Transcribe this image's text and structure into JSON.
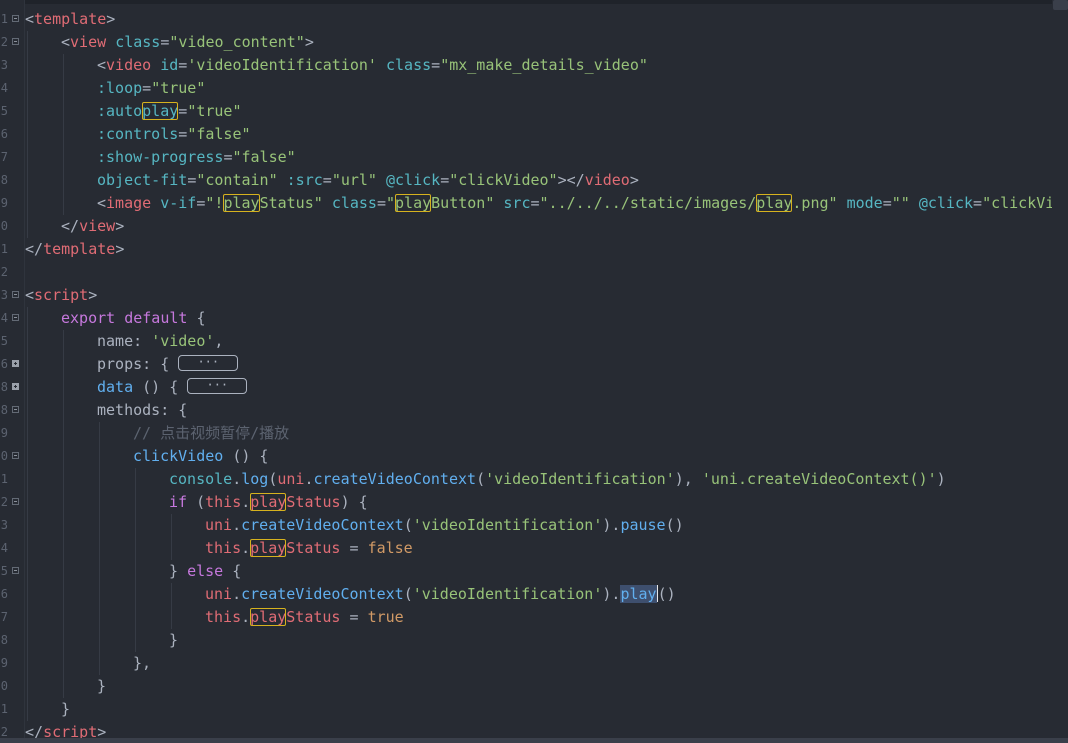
{
  "editor": {
    "lines": [
      {
        "num": "1",
        "fold": "minus",
        "tokens": [
          {
            "t": "<",
            "c": "plain"
          },
          {
            "t": "template",
            "c": "tag"
          },
          {
            "t": ">",
            "c": "plain"
          }
        ]
      },
      {
        "num": "2",
        "fold": "minus",
        "indent": 1,
        "tokens": [
          {
            "t": "<",
            "c": "plain"
          },
          {
            "t": "view",
            "c": "tag"
          },
          {
            "t": " ",
            "c": "plain"
          },
          {
            "t": "class",
            "c": "attr"
          },
          {
            "t": "=",
            "c": "plain"
          },
          {
            "t": "\"video_content\"",
            "c": "str"
          },
          {
            "t": ">",
            "c": "plain"
          }
        ]
      },
      {
        "num": "3",
        "indent": 2,
        "tokens": [
          {
            "t": "<",
            "c": "plain"
          },
          {
            "t": "video",
            "c": "tag"
          },
          {
            "t": " ",
            "c": "plain"
          },
          {
            "t": "id",
            "c": "attr"
          },
          {
            "t": "=",
            "c": "plain"
          },
          {
            "t": "'videoIdentification'",
            "c": "str"
          },
          {
            "t": " ",
            "c": "plain"
          },
          {
            "t": "class",
            "c": "attr"
          },
          {
            "t": "=",
            "c": "plain"
          },
          {
            "t": "\"mx_make_details_video\"",
            "c": "str"
          }
        ]
      },
      {
        "num": "4",
        "indent": 2,
        "tokens": [
          {
            "t": ":loop",
            "c": "attr"
          },
          {
            "t": "=",
            "c": "plain"
          },
          {
            "t": "\"true\"",
            "c": "str"
          }
        ]
      },
      {
        "num": "5",
        "indent": 2,
        "tokens": [
          {
            "t": ":auto",
            "c": "attr"
          },
          {
            "t": "play",
            "c": "attr",
            "hl": true
          },
          {
            "t": "=",
            "c": "plain"
          },
          {
            "t": "\"true\"",
            "c": "str"
          }
        ]
      },
      {
        "num": "6",
        "indent": 2,
        "tokens": [
          {
            "t": ":controls",
            "c": "attr"
          },
          {
            "t": "=",
            "c": "plain"
          },
          {
            "t": "\"false\"",
            "c": "str"
          }
        ]
      },
      {
        "num": "7",
        "indent": 2,
        "tokens": [
          {
            "t": ":show-progress",
            "c": "attr"
          },
          {
            "t": "=",
            "c": "plain"
          },
          {
            "t": "\"false\"",
            "c": "str"
          }
        ]
      },
      {
        "num": "8",
        "indent": 2,
        "tokens": [
          {
            "t": "object-fit",
            "c": "attr"
          },
          {
            "t": "=",
            "c": "plain"
          },
          {
            "t": "\"contain\"",
            "c": "str"
          },
          {
            "t": " ",
            "c": "plain"
          },
          {
            "t": ":src",
            "c": "attr"
          },
          {
            "t": "=",
            "c": "plain"
          },
          {
            "t": "\"url\"",
            "c": "str"
          },
          {
            "t": " ",
            "c": "plain"
          },
          {
            "t": "@click",
            "c": "attr"
          },
          {
            "t": "=",
            "c": "plain"
          },
          {
            "t": "\"clickVideo\"",
            "c": "str"
          },
          {
            "t": "></",
            "c": "plain"
          },
          {
            "t": "video",
            "c": "tag"
          },
          {
            "t": ">",
            "c": "plain"
          }
        ]
      },
      {
        "num": "9",
        "indent": 2,
        "tokens": [
          {
            "t": "<",
            "c": "plain"
          },
          {
            "t": "image",
            "c": "tag"
          },
          {
            "t": " ",
            "c": "plain"
          },
          {
            "t": "v-if",
            "c": "attr"
          },
          {
            "t": "=",
            "c": "plain"
          },
          {
            "t": "\"!",
            "c": "str"
          },
          {
            "t": "play",
            "c": "str",
            "hl": true
          },
          {
            "t": "Status\"",
            "c": "str"
          },
          {
            "t": " ",
            "c": "plain"
          },
          {
            "t": "class",
            "c": "attr"
          },
          {
            "t": "=",
            "c": "plain"
          },
          {
            "t": "\"",
            "c": "str"
          },
          {
            "t": "play",
            "c": "str",
            "hl": true
          },
          {
            "t": "Button\"",
            "c": "str"
          },
          {
            "t": " ",
            "c": "plain"
          },
          {
            "t": "src",
            "c": "attr"
          },
          {
            "t": "=",
            "c": "plain"
          },
          {
            "t": "\"../../../static/images/",
            "c": "str"
          },
          {
            "t": "play",
            "c": "str",
            "hl": true
          },
          {
            "t": ".png\"",
            "c": "str"
          },
          {
            "t": " ",
            "c": "plain"
          },
          {
            "t": "mode",
            "c": "attr"
          },
          {
            "t": "=",
            "c": "plain"
          },
          {
            "t": "\"\"",
            "c": "str"
          },
          {
            "t": " ",
            "c": "plain"
          },
          {
            "t": "@click",
            "c": "attr"
          },
          {
            "t": "=",
            "c": "plain"
          },
          {
            "t": "\"clickVide",
            "c": "str"
          }
        ]
      },
      {
        "num": "0",
        "indent": 1,
        "tokens": [
          {
            "t": "</",
            "c": "plain"
          },
          {
            "t": "view",
            "c": "tag"
          },
          {
            "t": ">",
            "c": "plain"
          }
        ]
      },
      {
        "num": "1",
        "tokens": [
          {
            "t": "</",
            "c": "plain"
          },
          {
            "t": "template",
            "c": "tag"
          },
          {
            "t": ">",
            "c": "plain"
          }
        ]
      },
      {
        "num": "2",
        "tokens": []
      },
      {
        "num": "3",
        "fold": "minus",
        "tokens": [
          {
            "t": "<",
            "c": "plain"
          },
          {
            "t": "script",
            "c": "tag"
          },
          {
            "t": ">",
            "c": "plain"
          }
        ]
      },
      {
        "num": "4",
        "fold": "minus",
        "indent": 1,
        "tokens": [
          {
            "t": "export",
            "c": "kw"
          },
          {
            "t": " ",
            "c": "plain"
          },
          {
            "t": "default",
            "c": "kw"
          },
          {
            "t": " {",
            "c": "plain"
          }
        ]
      },
      {
        "num": "5",
        "indent": 2,
        "tokens": [
          {
            "t": "name",
            "c": "plain"
          },
          {
            "t": ": ",
            "c": "plain"
          },
          {
            "t": "'video'",
            "c": "str"
          },
          {
            "t": ",",
            "c": "plain"
          }
        ]
      },
      {
        "num": "6",
        "fold": "plus",
        "indent": 2,
        "tokens": [
          {
            "t": "props",
            "c": "plain"
          },
          {
            "t": ": { ",
            "c": "plain"
          },
          {
            "t": "···",
            "c": "plain",
            "folded": true
          }
        ]
      },
      {
        "num": "8",
        "fold": "plus",
        "indent": 2,
        "tokens": [
          {
            "t": "data",
            "c": "fn"
          },
          {
            "t": " () { ",
            "c": "plain"
          },
          {
            "t": "···",
            "c": "plain",
            "folded": true
          }
        ]
      },
      {
        "num": "8",
        "fold": "minus",
        "indent": 2,
        "tokens": [
          {
            "t": "methods",
            "c": "plain"
          },
          {
            "t": ": {",
            "c": "plain"
          }
        ]
      },
      {
        "num": "9",
        "indent": 3,
        "tokens": [
          {
            "t": "// 点击视频暂停/播放",
            "c": "cmt"
          }
        ]
      },
      {
        "num": "0",
        "fold": "minus",
        "indent": 3,
        "tokens": [
          {
            "t": "clickVideo",
            "c": "fn"
          },
          {
            "t": " () {",
            "c": "plain"
          }
        ]
      },
      {
        "num": "1",
        "indent": 4,
        "tokens": [
          {
            "t": "console",
            "c": "obj"
          },
          {
            "t": ".",
            "c": "plain"
          },
          {
            "t": "log",
            "c": "fn"
          },
          {
            "t": "(",
            "c": "plain"
          },
          {
            "t": "uni",
            "c": "this"
          },
          {
            "t": ".",
            "c": "plain"
          },
          {
            "t": "createVideoContext",
            "c": "fn"
          },
          {
            "t": "(",
            "c": "plain"
          },
          {
            "t": "'videoIdentification'",
            "c": "str"
          },
          {
            "t": "), ",
            "c": "plain"
          },
          {
            "t": "'uni.createVideoContext()'",
            "c": "str"
          },
          {
            "t": ")",
            "c": "plain"
          }
        ]
      },
      {
        "num": "2",
        "fold": "minus",
        "indent": 4,
        "tokens": [
          {
            "t": "if",
            "c": "kw"
          },
          {
            "t": " (",
            "c": "plain"
          },
          {
            "t": "this",
            "c": "this"
          },
          {
            "t": ".",
            "c": "plain"
          },
          {
            "t": "play",
            "c": "this",
            "hl": true
          },
          {
            "t": "Status",
            "c": "this"
          },
          {
            "t": ") {",
            "c": "plain"
          }
        ]
      },
      {
        "num": "3",
        "indent": 5,
        "tokens": [
          {
            "t": "uni",
            "c": "this"
          },
          {
            "t": ".",
            "c": "plain"
          },
          {
            "t": "createVideoContext",
            "c": "fn"
          },
          {
            "t": "(",
            "c": "plain"
          },
          {
            "t": "'videoIdentification'",
            "c": "str"
          },
          {
            "t": ").",
            "c": "plain"
          },
          {
            "t": "pause",
            "c": "fn"
          },
          {
            "t": "()",
            "c": "plain"
          }
        ]
      },
      {
        "num": "4",
        "indent": 5,
        "tokens": [
          {
            "t": "this",
            "c": "this"
          },
          {
            "t": ".",
            "c": "plain"
          },
          {
            "t": "play",
            "c": "this",
            "hl": true
          },
          {
            "t": "Status",
            "c": "this"
          },
          {
            "t": " = ",
            "c": "plain"
          },
          {
            "t": "false",
            "c": "bool"
          }
        ]
      },
      {
        "num": "5",
        "fold": "minus",
        "indent": 4,
        "tokens": [
          {
            "t": "} ",
            "c": "plain"
          },
          {
            "t": "else",
            "c": "kw"
          },
          {
            "t": " {",
            "c": "plain"
          }
        ]
      },
      {
        "num": "6",
        "indent": 5,
        "tokens": [
          {
            "t": "uni",
            "c": "this"
          },
          {
            "t": ".",
            "c": "plain"
          },
          {
            "t": "createVideoContext",
            "c": "fn"
          },
          {
            "t": "(",
            "c": "plain"
          },
          {
            "t": "'videoIdentification'",
            "c": "str"
          },
          {
            "t": ").",
            "c": "plain"
          },
          {
            "t": "play",
            "c": "fn",
            "sel": true
          },
          {
            "t": "()",
            "c": "plain",
            "cursor": true
          }
        ]
      },
      {
        "num": "7",
        "indent": 5,
        "tokens": [
          {
            "t": "this",
            "c": "this"
          },
          {
            "t": ".",
            "c": "plain"
          },
          {
            "t": "play",
            "c": "this",
            "hl": true
          },
          {
            "t": "Status",
            "c": "this"
          },
          {
            "t": " = ",
            "c": "plain"
          },
          {
            "t": "true",
            "c": "bool"
          }
        ]
      },
      {
        "num": "8",
        "indent": 4,
        "tokens": [
          {
            "t": "}",
            "c": "plain"
          }
        ]
      },
      {
        "num": "9",
        "indent": 3,
        "tokens": [
          {
            "t": "},",
            "c": "plain"
          }
        ]
      },
      {
        "num": "0",
        "indent": 2,
        "tokens": [
          {
            "t": "}",
            "c": "plain"
          }
        ]
      },
      {
        "num": "1",
        "indent": 1,
        "tokens": [
          {
            "t": "}",
            "c": "plain"
          }
        ]
      },
      {
        "num": "2",
        "tokens": [
          {
            "t": "</",
            "c": "plain"
          },
          {
            "t": "script",
            "c": "tag"
          },
          {
            "t": ">",
            "c": "plain"
          }
        ]
      }
    ]
  },
  "colors": {
    "background": "#272b33",
    "tag": "#e06c75",
    "attribute": "#56b6c2",
    "string": "#98c379",
    "keyword": "#c678dd",
    "function": "#61afef",
    "comment": "#5c6370",
    "boolean": "#d19a66",
    "highlight_box": "#d6b21e",
    "selection": "#3e4f6e"
  }
}
